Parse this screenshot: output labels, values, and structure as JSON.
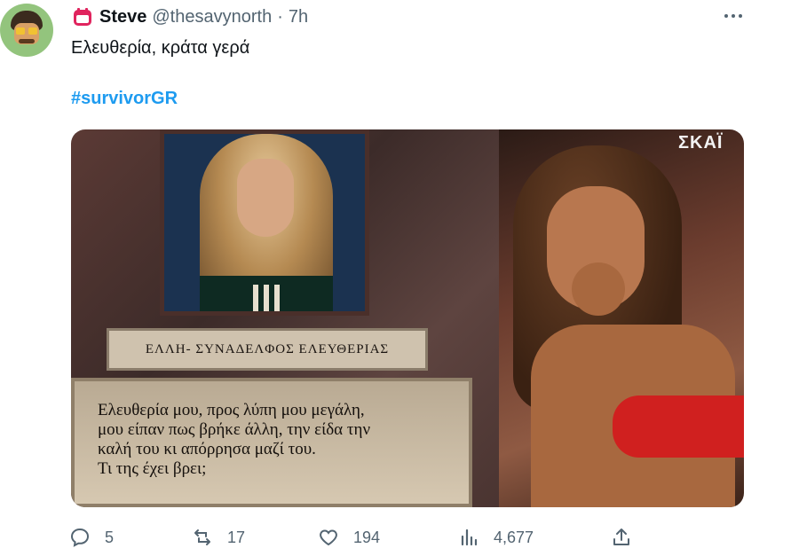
{
  "tweet": {
    "display_name": "Steve",
    "handle": "@thesavynorth",
    "separator": "·",
    "time": "7h",
    "text": "Ελευθερία, κράτα γερά",
    "hashtag": "#survivorGR"
  },
  "media": {
    "left": {
      "name_plate": "ΕΛΛΗ- ΣΥΝΑΔΕΛΦΟΣ ΕΛΕΥΘΕΡΙΑΣ",
      "quote_lines": [
        "Ελευθερία μου, προς λύπη μου μεγάλη,",
        "μου είπαν πως βρήκε άλλη, την είδα την",
        "καλή του κι απόρρησα μαζί του.",
        "Τι της έχει βρει;"
      ]
    },
    "right": {
      "channel_logo": "ΣΚΑΪ"
    }
  },
  "actions": {
    "replies": "5",
    "retweets": "17",
    "likes": "194",
    "views": "4,677"
  },
  "icons": {
    "badge": "calendar-badge-icon",
    "more": "more-icon",
    "reply": "reply-icon",
    "retweet": "retweet-icon",
    "like": "heart-icon",
    "views": "views-icon",
    "share": "share-icon"
  },
  "colors": {
    "accent": "#1d9bf0",
    "secondary_text": "#536471",
    "badge_red": "#e0245e"
  }
}
